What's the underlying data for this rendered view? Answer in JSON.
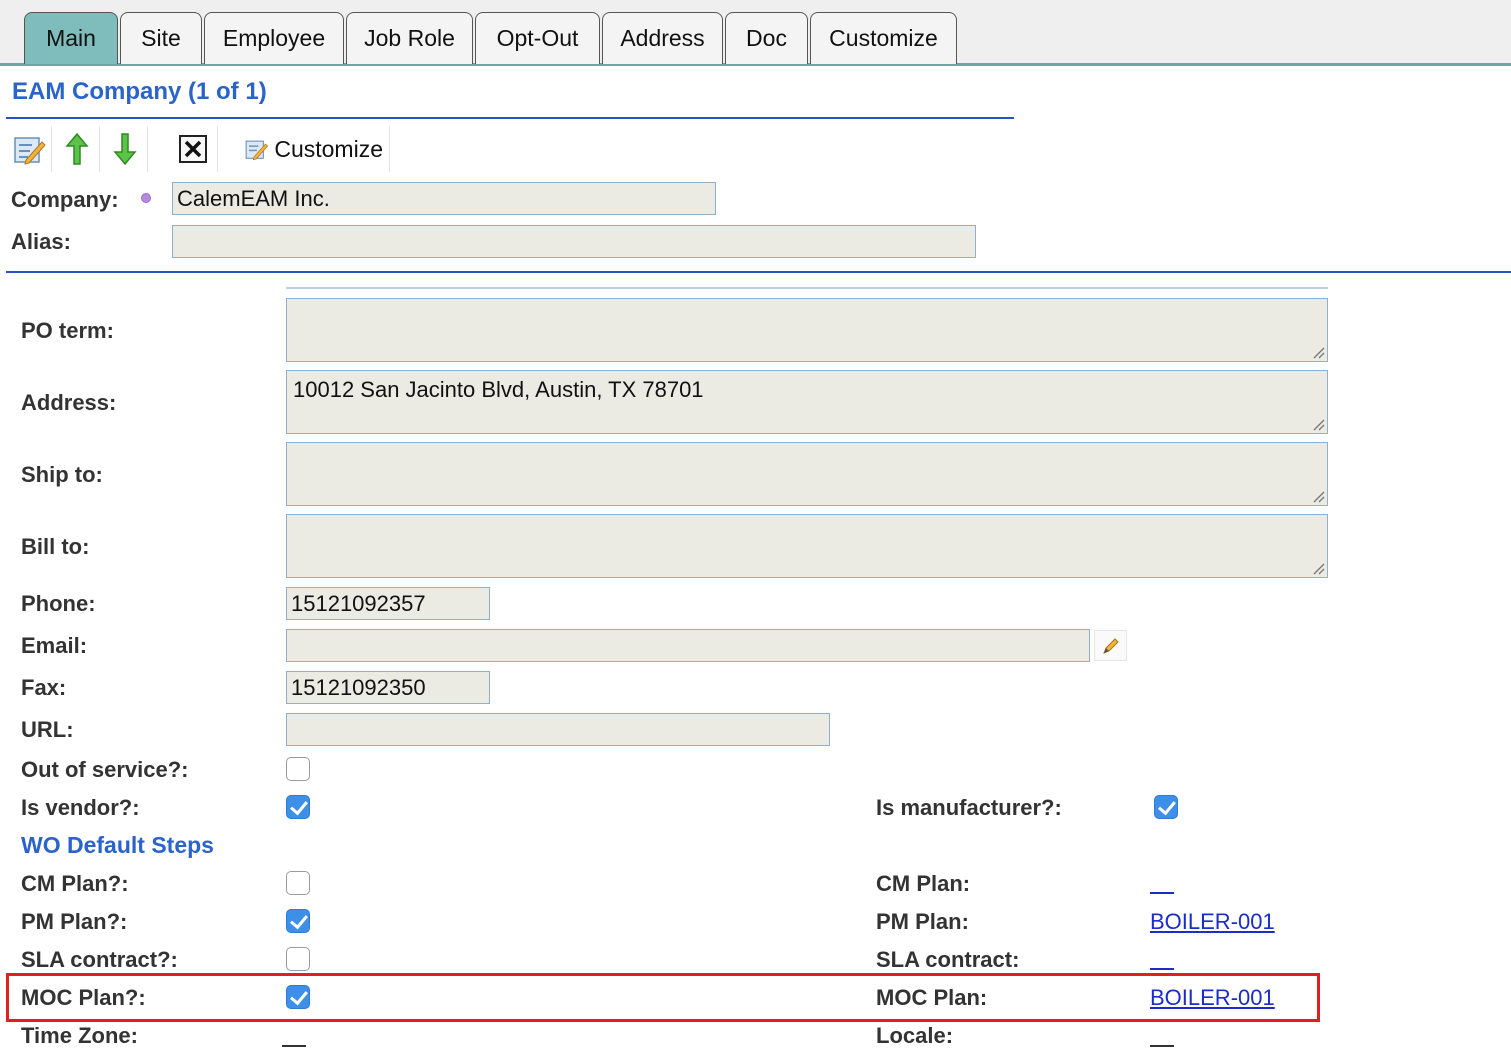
{
  "tabs": [
    "Main",
    "Site",
    "Employee",
    "Job Role",
    "Opt-Out",
    "Address",
    "Doc",
    "Customize"
  ],
  "header": {
    "title": "EAM Company (1 of 1)"
  },
  "toolbar": {
    "customize_label": "Customize"
  },
  "fields": {
    "company": {
      "label": "Company:",
      "value": "CalemEAM Inc."
    },
    "alias": {
      "label": "Alias:",
      "value": ""
    },
    "po_term": {
      "label": "PO term:",
      "value": ""
    },
    "address": {
      "label": "Address:",
      "value": "10012 San Jacinto Blvd, Austin, TX 78701"
    },
    "ship_to": {
      "label": "Ship to:",
      "value": ""
    },
    "bill_to": {
      "label": "Bill to:",
      "value": ""
    },
    "phone": {
      "label": "Phone:",
      "value": "15121092357"
    },
    "email": {
      "label": "Email:",
      "value": ""
    },
    "fax": {
      "label": "Fax:",
      "value": "15121092350"
    },
    "url": {
      "label": "URL:",
      "value": ""
    },
    "out_of_service": {
      "label": "Out of service?:",
      "checked": false
    },
    "is_vendor": {
      "label": "Is vendor?:",
      "checked": true
    },
    "is_manufacturer": {
      "label": "Is manufacturer?:",
      "checked": true
    }
  },
  "wo_section": {
    "title": "WO Default Steps",
    "cm_plan_q": {
      "label": "CM Plan?:",
      "checked": false
    },
    "cm_plan": {
      "label": "CM Plan:",
      "value": ""
    },
    "pm_plan_q": {
      "label": "PM Plan?:",
      "checked": true
    },
    "pm_plan": {
      "label": "PM Plan:",
      "value": "BOILER-001"
    },
    "sla_contract_q": {
      "label": "SLA contract?:",
      "checked": false
    },
    "sla_contract": {
      "label": "SLA contract:",
      "value": ""
    },
    "moc_plan_q": {
      "label": "MOC Plan?:",
      "checked": true
    },
    "moc_plan": {
      "label": "MOC Plan:",
      "value": "BOILER-001"
    }
  },
  "time_zone": {
    "label": "Time Zone:",
    "value": ""
  },
  "locale": {
    "label": "Locale:",
    "value": ""
  },
  "colors": {
    "tab_active": "#7fbcbc",
    "link": "#1a2ccc",
    "title": "#2a63c9",
    "highlight": "#e02020"
  }
}
